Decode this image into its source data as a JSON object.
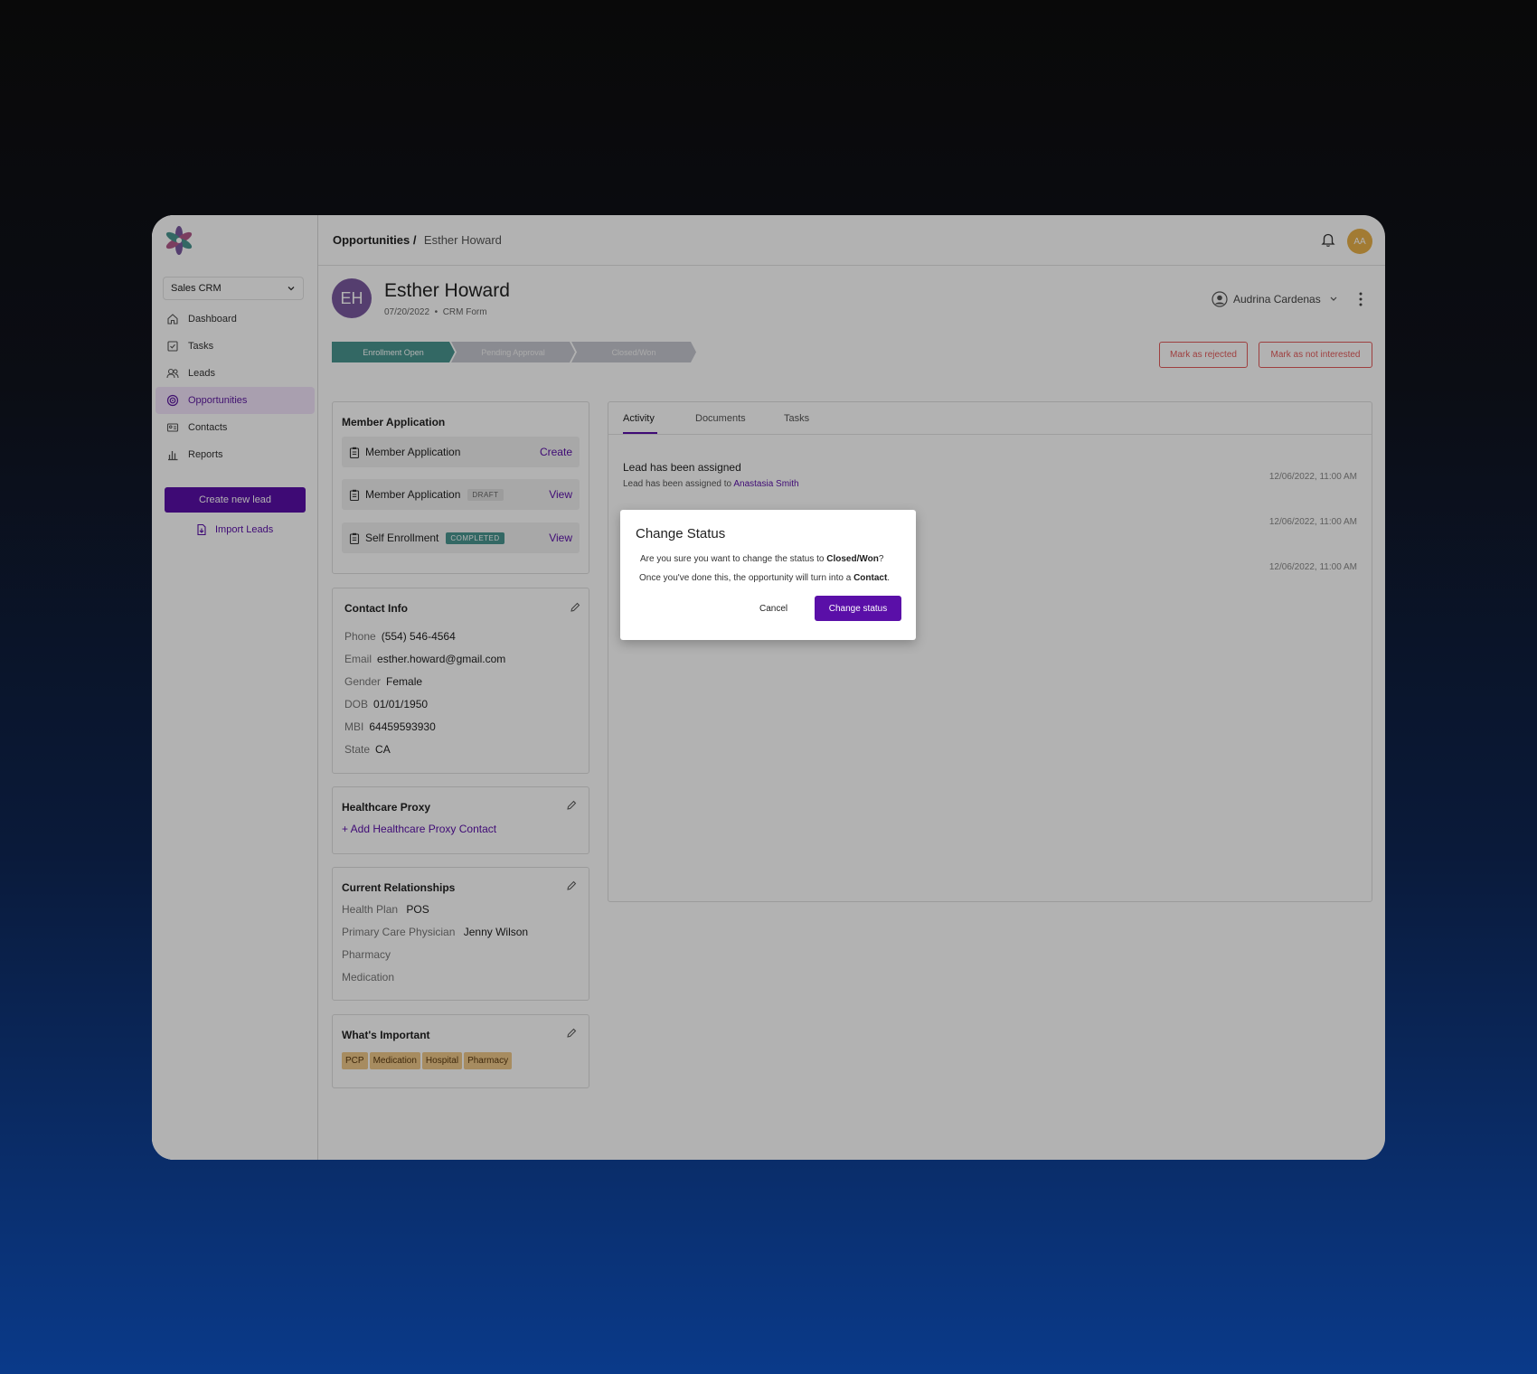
{
  "breadcrumb": {
    "root": "Opportunities /",
    "current": "Esther Howard"
  },
  "sidebar": {
    "workspace": "Sales CRM",
    "items": [
      {
        "label": "Dashboard",
        "icon": "home-icon"
      },
      {
        "label": "Tasks",
        "icon": "tasks-icon"
      },
      {
        "label": "Leads",
        "icon": "users-icon"
      },
      {
        "label": "Opportunities",
        "icon": "target-icon",
        "active": true
      },
      {
        "label": "Contacts",
        "icon": "contact-card-icon"
      },
      {
        "label": "Reports",
        "icon": "bar-chart-icon"
      }
    ],
    "create_button": "Create new lead",
    "import_link": "Import Leads"
  },
  "user": {
    "initials": "AA"
  },
  "profile": {
    "initials": "EH",
    "name": "Esther Howard",
    "date": "07/20/2022",
    "separator": "•",
    "source": "CRM Form",
    "owner": "Audrina Cardenas"
  },
  "stages": [
    "Enrollment Open",
    "Pending Approval",
    "Closed/Won"
  ],
  "actions": {
    "reject": "Mark as rejected",
    "not_interested": "Mark as not interested"
  },
  "member_application": {
    "title": "Member Application",
    "rows": [
      {
        "label": "Member Application",
        "tag": "",
        "action": "Create"
      },
      {
        "label": "Member Application",
        "tag": "DRAFT",
        "action": "View"
      },
      {
        "label": "Self Enrollment",
        "tag": "COMPLETED",
        "action": "View"
      }
    ]
  },
  "contact_info": {
    "title": "Contact Info",
    "fields": [
      {
        "label": "Phone",
        "value": "(554) 546-4564"
      },
      {
        "label": "Email",
        "value": "esther.howard@gmail.com"
      },
      {
        "label": "Gender",
        "value": "Female"
      },
      {
        "label": "DOB",
        "value": "01/01/1950"
      },
      {
        "label": "MBI",
        "value": "64459593930"
      },
      {
        "label": "State",
        "value": "CA"
      }
    ]
  },
  "healthcare_proxy": {
    "title": "Healthcare Proxy",
    "add_link": "+ Add Healthcare Proxy Contact"
  },
  "relationships": {
    "title": "Current Relationships",
    "fields": [
      {
        "label": "Health Plan",
        "value": "POS"
      },
      {
        "label": "Primary Care Physician",
        "value": "Jenny Wilson"
      },
      {
        "label": "Pharmacy",
        "value": ""
      },
      {
        "label": "Medication",
        "value": ""
      }
    ]
  },
  "important": {
    "title": "What's Important",
    "chips": [
      "PCP",
      "Medication",
      "Hospital",
      "Pharmacy"
    ]
  },
  "activity": {
    "tabs": [
      "Activity",
      "Documents",
      "Tasks"
    ],
    "entries": [
      {
        "title": "Lead has been assigned",
        "desc": "Lead has been assigned to",
        "link": "Anastasia Smith",
        "time": "12/06/2022, 11:00 AM"
      },
      {
        "title": "",
        "desc": "",
        "link": "",
        "time": "12/06/2022, 11:00 AM"
      },
      {
        "title": "",
        "desc": "",
        "link": "",
        "time": "12/06/2022, 11:00 AM"
      }
    ]
  },
  "modal": {
    "title": "Change Status",
    "line1_pre": "Are you sure you want to change the status to",
    "line1_bold": "Closed/Won",
    "line1_post": "?",
    "line2_pre": "Once you've done this, the opportunity will turn into a",
    "line2_bold": "Contact",
    "line2_post": ".",
    "cancel": "Cancel",
    "confirm": "Change status"
  },
  "colors": {
    "brand": "#5a0fa8",
    "stage_active": "#4a9690",
    "danger": "#e35b5b",
    "chip": "#f0c98a"
  }
}
